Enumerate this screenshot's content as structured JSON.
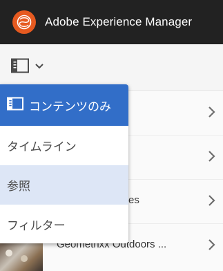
{
  "header": {
    "logo_icon": "adobe-experience-manager-logo",
    "title": "Adobe Experience Manager"
  },
  "toolbar": {
    "rail_icon": "rail-toggle-icon",
    "dropdown_icon": "chevron-down-icon"
  },
  "menu": {
    "items": [
      {
        "label": "コンテンツのみ",
        "icon": "content-only-icon",
        "state": "selected"
      },
      {
        "label": "タイムライン",
        "state": "normal"
      },
      {
        "label": "参照",
        "state": "hover"
      },
      {
        "label": "フィルター",
        "state": "normal"
      }
    ]
  },
  "rows": [
    {
      "title": ""
    },
    {
      "title": ""
    },
    {
      "title": "es"
    },
    {
      "title": "Geometrixx Outdoors ..."
    }
  ],
  "colors": {
    "header_bg": "#222222",
    "logo_orange": "#e65a20",
    "selected_blue": "#326ec8",
    "hover_blue": "#dde6f6"
  }
}
